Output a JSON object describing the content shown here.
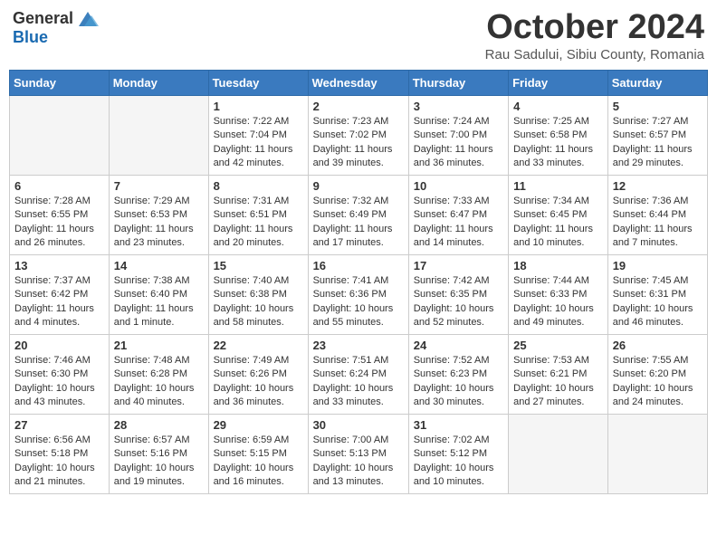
{
  "header": {
    "logo_general": "General",
    "logo_blue": "Blue",
    "month_title": "October 2024",
    "location": "Rau Sadului, Sibiu County, Romania"
  },
  "weekdays": [
    "Sunday",
    "Monday",
    "Tuesday",
    "Wednesday",
    "Thursday",
    "Friday",
    "Saturday"
  ],
  "weeks": [
    [
      {
        "day": "",
        "info": ""
      },
      {
        "day": "",
        "info": ""
      },
      {
        "day": "1",
        "info": "Sunrise: 7:22 AM\nSunset: 7:04 PM\nDaylight: 11 hours and 42 minutes."
      },
      {
        "day": "2",
        "info": "Sunrise: 7:23 AM\nSunset: 7:02 PM\nDaylight: 11 hours and 39 minutes."
      },
      {
        "day": "3",
        "info": "Sunrise: 7:24 AM\nSunset: 7:00 PM\nDaylight: 11 hours and 36 minutes."
      },
      {
        "day": "4",
        "info": "Sunrise: 7:25 AM\nSunset: 6:58 PM\nDaylight: 11 hours and 33 minutes."
      },
      {
        "day": "5",
        "info": "Sunrise: 7:27 AM\nSunset: 6:57 PM\nDaylight: 11 hours and 29 minutes."
      }
    ],
    [
      {
        "day": "6",
        "info": "Sunrise: 7:28 AM\nSunset: 6:55 PM\nDaylight: 11 hours and 26 minutes."
      },
      {
        "day": "7",
        "info": "Sunrise: 7:29 AM\nSunset: 6:53 PM\nDaylight: 11 hours and 23 minutes."
      },
      {
        "day": "8",
        "info": "Sunrise: 7:31 AM\nSunset: 6:51 PM\nDaylight: 11 hours and 20 minutes."
      },
      {
        "day": "9",
        "info": "Sunrise: 7:32 AM\nSunset: 6:49 PM\nDaylight: 11 hours and 17 minutes."
      },
      {
        "day": "10",
        "info": "Sunrise: 7:33 AM\nSunset: 6:47 PM\nDaylight: 11 hours and 14 minutes."
      },
      {
        "day": "11",
        "info": "Sunrise: 7:34 AM\nSunset: 6:45 PM\nDaylight: 11 hours and 10 minutes."
      },
      {
        "day": "12",
        "info": "Sunrise: 7:36 AM\nSunset: 6:44 PM\nDaylight: 11 hours and 7 minutes."
      }
    ],
    [
      {
        "day": "13",
        "info": "Sunrise: 7:37 AM\nSunset: 6:42 PM\nDaylight: 11 hours and 4 minutes."
      },
      {
        "day": "14",
        "info": "Sunrise: 7:38 AM\nSunset: 6:40 PM\nDaylight: 11 hours and 1 minute."
      },
      {
        "day": "15",
        "info": "Sunrise: 7:40 AM\nSunset: 6:38 PM\nDaylight: 10 hours and 58 minutes."
      },
      {
        "day": "16",
        "info": "Sunrise: 7:41 AM\nSunset: 6:36 PM\nDaylight: 10 hours and 55 minutes."
      },
      {
        "day": "17",
        "info": "Sunrise: 7:42 AM\nSunset: 6:35 PM\nDaylight: 10 hours and 52 minutes."
      },
      {
        "day": "18",
        "info": "Sunrise: 7:44 AM\nSunset: 6:33 PM\nDaylight: 10 hours and 49 minutes."
      },
      {
        "day": "19",
        "info": "Sunrise: 7:45 AM\nSunset: 6:31 PM\nDaylight: 10 hours and 46 minutes."
      }
    ],
    [
      {
        "day": "20",
        "info": "Sunrise: 7:46 AM\nSunset: 6:30 PM\nDaylight: 10 hours and 43 minutes."
      },
      {
        "day": "21",
        "info": "Sunrise: 7:48 AM\nSunset: 6:28 PM\nDaylight: 10 hours and 40 minutes."
      },
      {
        "day": "22",
        "info": "Sunrise: 7:49 AM\nSunset: 6:26 PM\nDaylight: 10 hours and 36 minutes."
      },
      {
        "day": "23",
        "info": "Sunrise: 7:51 AM\nSunset: 6:24 PM\nDaylight: 10 hours and 33 minutes."
      },
      {
        "day": "24",
        "info": "Sunrise: 7:52 AM\nSunset: 6:23 PM\nDaylight: 10 hours and 30 minutes."
      },
      {
        "day": "25",
        "info": "Sunrise: 7:53 AM\nSunset: 6:21 PM\nDaylight: 10 hours and 27 minutes."
      },
      {
        "day": "26",
        "info": "Sunrise: 7:55 AM\nSunset: 6:20 PM\nDaylight: 10 hours and 24 minutes."
      }
    ],
    [
      {
        "day": "27",
        "info": "Sunrise: 6:56 AM\nSunset: 5:18 PM\nDaylight: 10 hours and 21 minutes."
      },
      {
        "day": "28",
        "info": "Sunrise: 6:57 AM\nSunset: 5:16 PM\nDaylight: 10 hours and 19 minutes."
      },
      {
        "day": "29",
        "info": "Sunrise: 6:59 AM\nSunset: 5:15 PM\nDaylight: 10 hours and 16 minutes."
      },
      {
        "day": "30",
        "info": "Sunrise: 7:00 AM\nSunset: 5:13 PM\nDaylight: 10 hours and 13 minutes."
      },
      {
        "day": "31",
        "info": "Sunrise: 7:02 AM\nSunset: 5:12 PM\nDaylight: 10 hours and 10 minutes."
      },
      {
        "day": "",
        "info": ""
      },
      {
        "day": "",
        "info": ""
      }
    ]
  ]
}
